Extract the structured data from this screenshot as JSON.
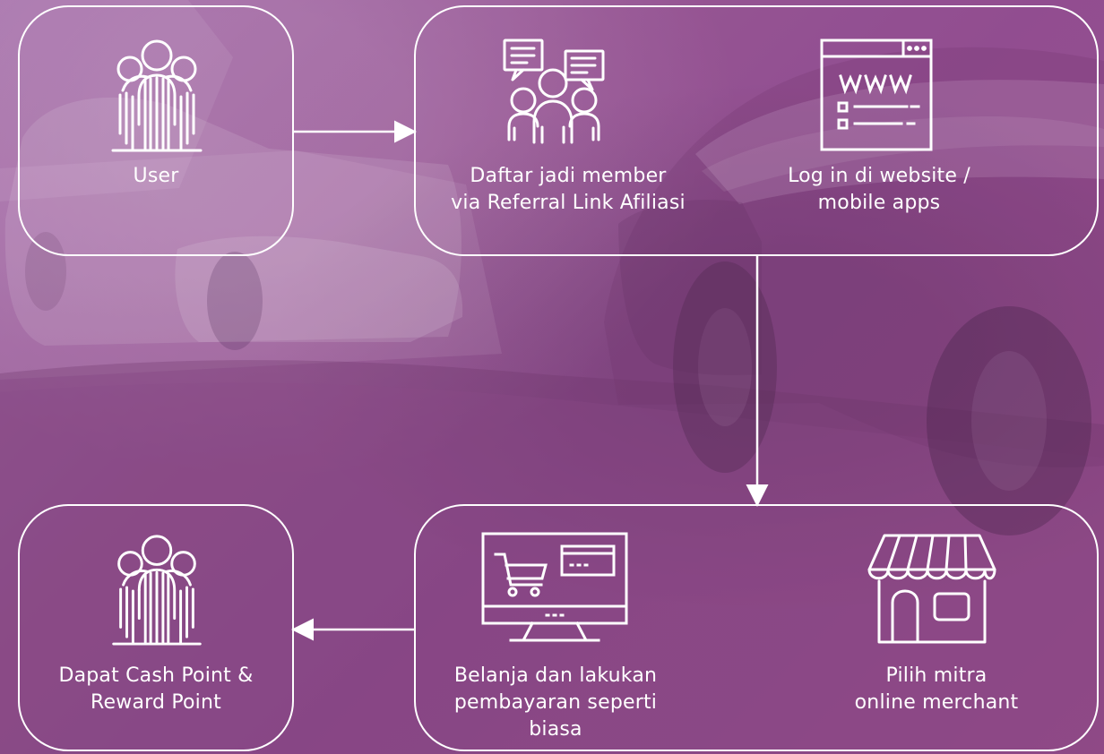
{
  "diagram": {
    "nodes": {
      "user": {
        "label": "User",
        "icon": "people-icon"
      },
      "member": {
        "label": "Daftar jadi member\nvia Referral Link Afiliasi",
        "icon": "group-chat-icon"
      },
      "login": {
        "label": "Log in di website /\nmobile apps",
        "icon": "www-browser-icon"
      },
      "shop": {
        "label": "Belanja dan lakukan\npembayaran seperti\nbiasa",
        "icon": "shopping-monitor-icon"
      },
      "mitra": {
        "label": "Pilih mitra\nonline merchant",
        "icon": "storefront-icon"
      },
      "reward": {
        "label": "Dapat Cash Point &\nReward Point",
        "icon": "people-icon"
      }
    },
    "colors": {
      "stroke": "#ffffff",
      "overlay": "#9b5a98"
    }
  }
}
